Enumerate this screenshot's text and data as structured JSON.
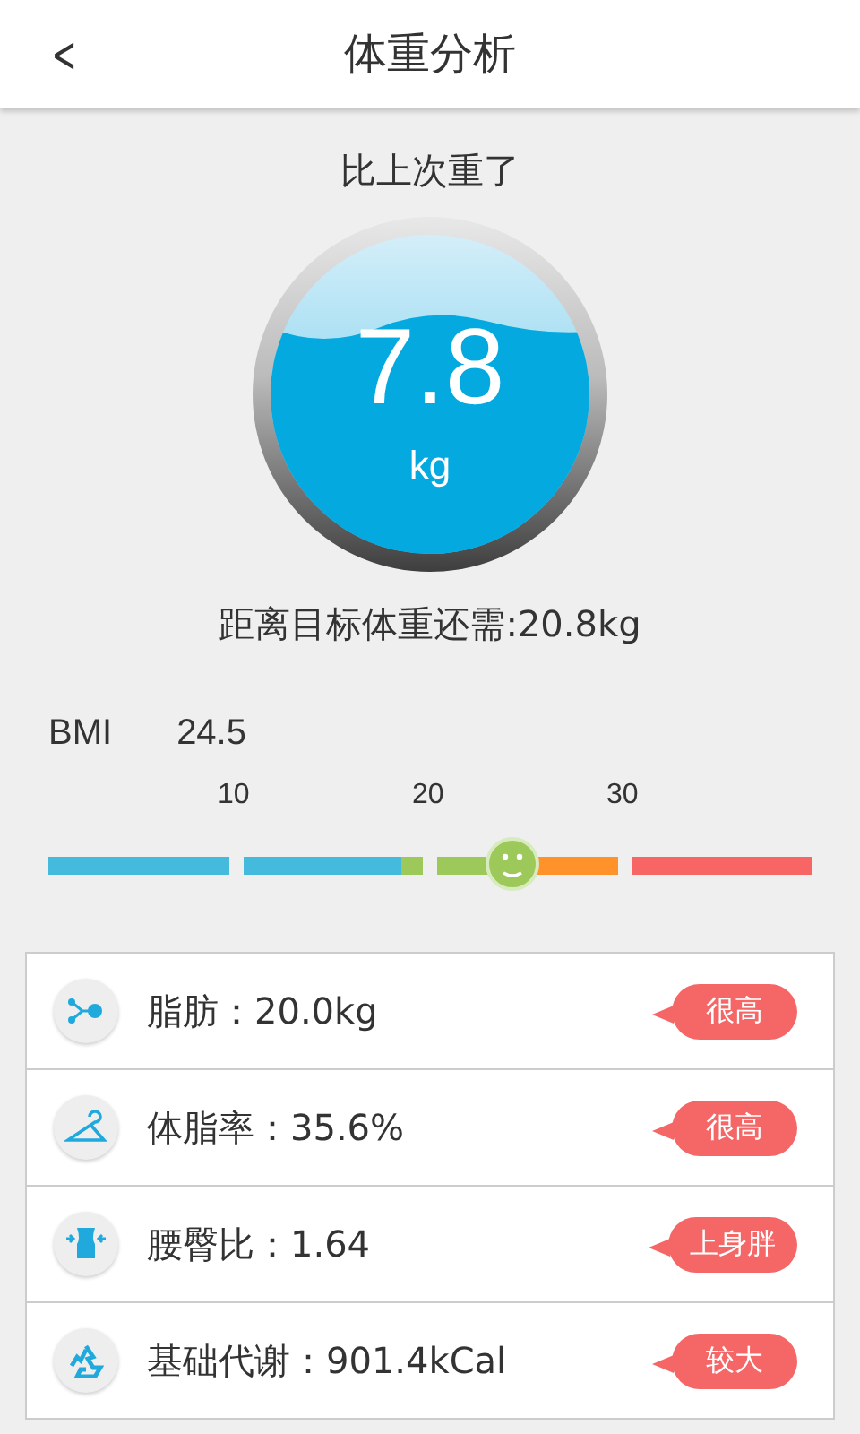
{
  "header": {
    "back": "<",
    "title": "体重分析"
  },
  "change": {
    "caption": "比上次重了",
    "value": "7.8",
    "unit": "kg"
  },
  "goal": "距离目标体重还需:20.8kg",
  "bmi": {
    "label": "BMI",
    "value": "24.5",
    "ticks": [
      "10",
      "20",
      "30"
    ]
  },
  "metrics": [
    {
      "kind": "fat",
      "text": "脂肪：20.0kg",
      "badge": "很高"
    },
    {
      "kind": "rate",
      "text": "体脂率：35.6%",
      "badge": "很高"
    },
    {
      "kind": "waist",
      "text": "腰臀比：1.64",
      "badge": "上身胖"
    },
    {
      "kind": "metabolism",
      "text": "基础代谢：901.4kCal",
      "badge": "较大"
    }
  ]
}
